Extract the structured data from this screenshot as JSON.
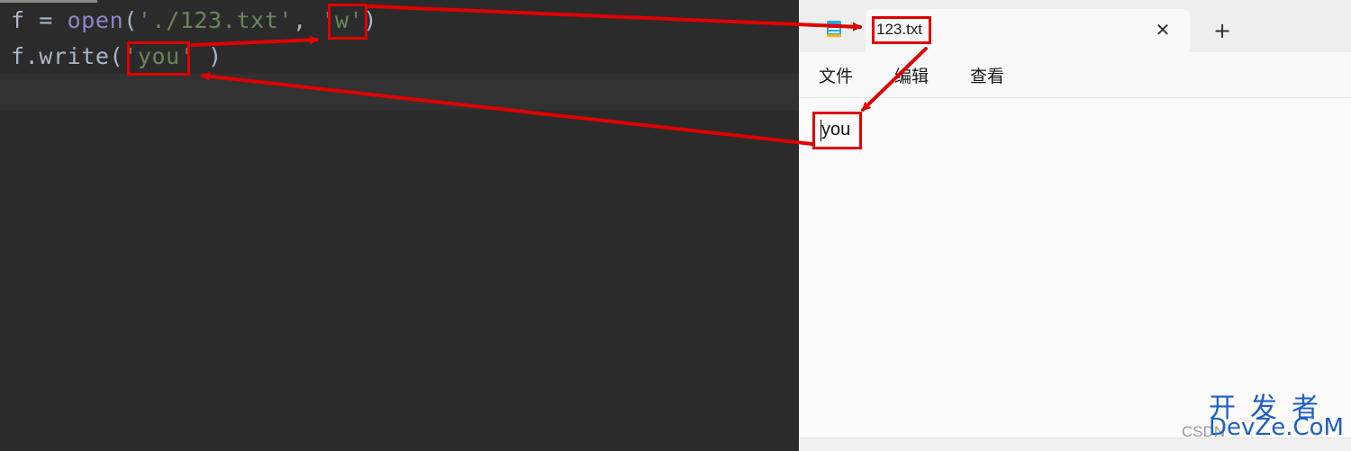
{
  "editor": {
    "line1": {
      "var": "f",
      "op": " = ",
      "fn": "open",
      "open_paren": "(",
      "path": "'./123.txt'",
      "comma": ", ",
      "mode": "'w'",
      "close_paren": ")"
    },
    "line2": {
      "prefix": "f.write(",
      "text": "'you'",
      "suffix": ")"
    }
  },
  "notepad": {
    "tab_title": "123.txt",
    "close_glyph": "✕",
    "new_tab_glyph": "+",
    "menu": [
      "文件",
      "编辑",
      "查看"
    ],
    "content": "you"
  },
  "annotations": {
    "color": "#e00000"
  },
  "watermark": {
    "brand_cn": "开发者",
    "brand_domain": "DevZe.CoM",
    "small_text": "CSDN"
  }
}
